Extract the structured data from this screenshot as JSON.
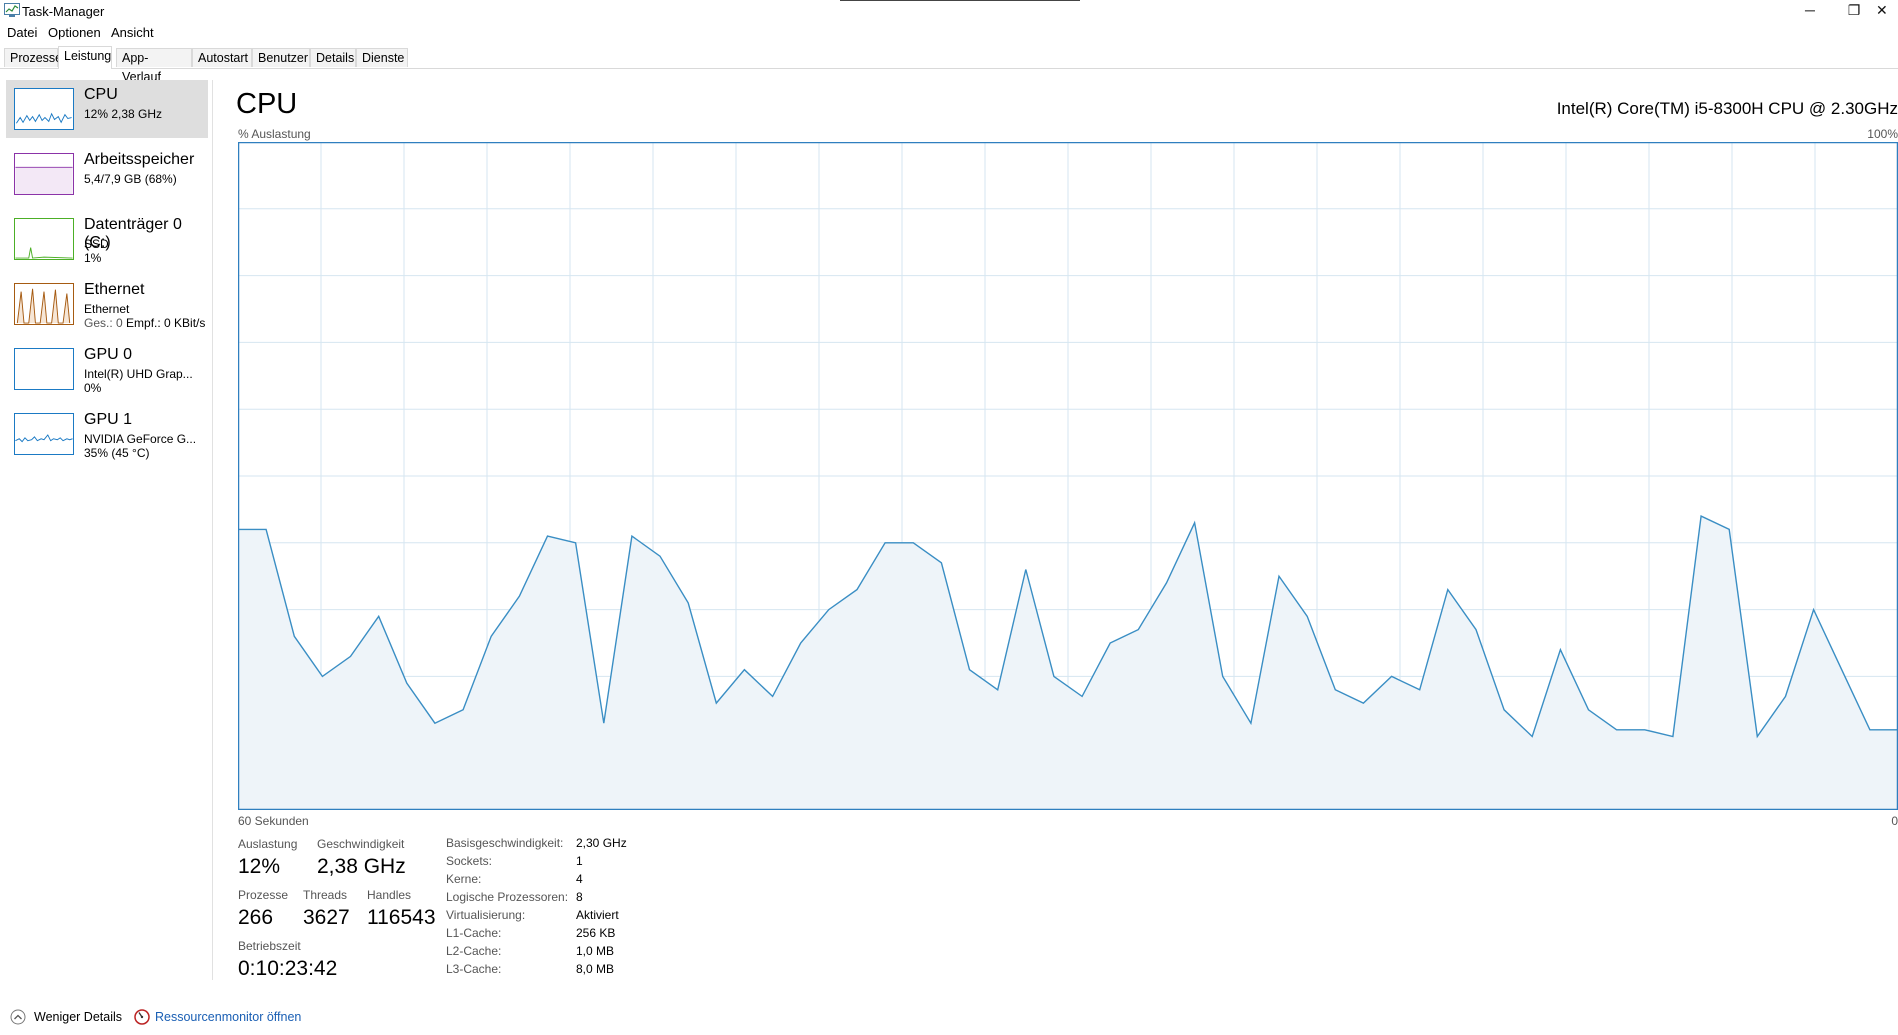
{
  "window": {
    "title": "Task-Manager",
    "controls": {
      "minimize": "─",
      "maximize": "❐",
      "close": "✕"
    }
  },
  "menu": [
    "Datei",
    "Optionen",
    "Ansicht"
  ],
  "tabs": [
    "Prozesse",
    "Leistung",
    "App-Verlauf",
    "Autostart",
    "Benutzer",
    "Details",
    "Dienste"
  ],
  "active_tab": "Leistung",
  "sidebar": [
    {
      "name": "CPU",
      "line1": "12% 2,38 GHz",
      "line2": "",
      "color": "#1b7ac4",
      "active": true
    },
    {
      "name": "Arbeitsspeicher",
      "line1": "5,4/7,9 GB (68%)",
      "line2": "",
      "color": "#8b33a8",
      "active": false
    },
    {
      "name": "Datenträger 0 (C:)",
      "line1": "SSD",
      "line2": "1%",
      "color": "#4caf26",
      "active": false
    },
    {
      "name": "Ethernet",
      "line1": "Ethernet",
      "line2_prefix": "Ges.: 0 ",
      "line2_rest": "Empf.: 0 KBit/s",
      "color": "#a65b12",
      "active": false
    },
    {
      "name": "GPU 0",
      "line1": "Intel(R) UHD Grap...",
      "line2": "0%",
      "color": "#1b7ac4",
      "active": false
    },
    {
      "name": "GPU 1",
      "line1": "NVIDIA GeForce G...",
      "line2": "35% (45 °C)",
      "color": "#1b7ac4",
      "active": false
    }
  ],
  "main": {
    "title": "CPU",
    "model": "Intel(R) Core(TM) i5-8300H CPU @ 2.30GHz",
    "y_label": "% Auslastung",
    "y_max_label": "100%",
    "x_left_label": "60 Sekunden",
    "x_right_label": "0"
  },
  "colors": {
    "line": "#3a8ec4",
    "fill": "#eef4f9",
    "grid": "#d6e6f1",
    "border": "#2f7fbf"
  },
  "chart_data": {
    "type": "area",
    "y_range": [
      0,
      100
    ],
    "x_range": [
      60,
      0
    ],
    "x_unit": "seconds ago",
    "grid": true,
    "values": [
      42,
      42,
      26,
      20,
      23,
      29,
      19,
      13,
      15,
      26,
      32,
      41,
      40,
      13,
      41,
      38,
      31,
      16,
      21,
      17,
      25,
      30,
      33,
      40,
      40,
      37,
      21,
      18,
      36,
      20,
      17,
      25,
      27,
      34,
      43,
      20,
      13,
      35,
      29,
      18,
      16,
      20,
      18,
      33,
      27,
      15,
      11,
      24,
      15,
      12,
      12,
      11,
      44,
      42,
      11,
      17,
      30,
      21,
      12,
      12
    ]
  },
  "stats": {
    "auslastung": {
      "label": "Auslastung",
      "value": "12%"
    },
    "geschwindigkeit": {
      "label": "Geschwindigkeit",
      "value": "2,38 GHz"
    },
    "prozesse": {
      "label": "Prozesse",
      "value": "266"
    },
    "threads": {
      "label": "Threads",
      "value": "3627"
    },
    "handles": {
      "label": "Handles",
      "value": "116543"
    },
    "betriebszeit": {
      "label": "Betriebszeit",
      "value": "0:10:23:42"
    }
  },
  "specs": [
    {
      "label": "Basisgeschwindigkeit:",
      "value": "2,30 GHz"
    },
    {
      "label": "Sockets:",
      "value": "1"
    },
    {
      "label": "Kerne:",
      "value": "4"
    },
    {
      "label": "Logische Prozessoren:",
      "value": "8"
    },
    {
      "label": "Virtualisierung:",
      "value": "Aktiviert"
    },
    {
      "label": "L1-Cache:",
      "value": "256 KB"
    },
    {
      "label": "L2-Cache:",
      "value": "1,0 MB"
    },
    {
      "label": "L3-Cache:",
      "value": "8,0 MB"
    }
  ],
  "bottom": {
    "fewer_details": "Weniger Details",
    "resource_monitor": "Ressourcenmonitor öffnen"
  }
}
